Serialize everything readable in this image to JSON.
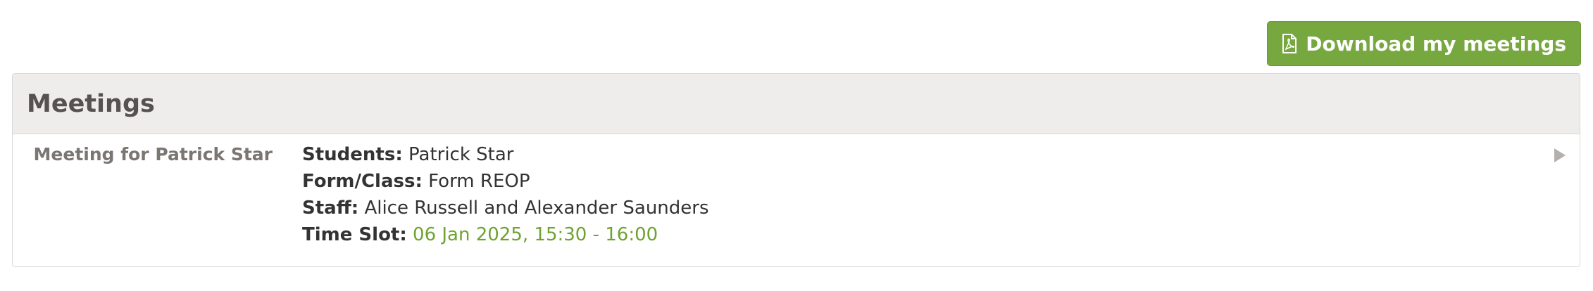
{
  "toolbar": {
    "download_label": "Download my meetings",
    "download_icon": "pdf-file-icon"
  },
  "panel": {
    "title": "Meetings"
  },
  "meetings": [
    {
      "label": "Meeting for Patrick Star",
      "students_key": "Students:",
      "students_value": "Patrick Star",
      "form_key": "Form/Class:",
      "form_value": "Form REOP",
      "staff_key": "Staff:",
      "staff_value": "Alice Russell and Alexander Saunders",
      "slot_key": "Time Slot:",
      "slot_value": "06 Jan 2025, 15:30 - 16:00",
      "expand_icon": "play-arrow-icon"
    }
  ],
  "colors": {
    "accent": "#77a83f",
    "time_slot": "#6fa32f",
    "header_bg": "#eeedeb"
  }
}
